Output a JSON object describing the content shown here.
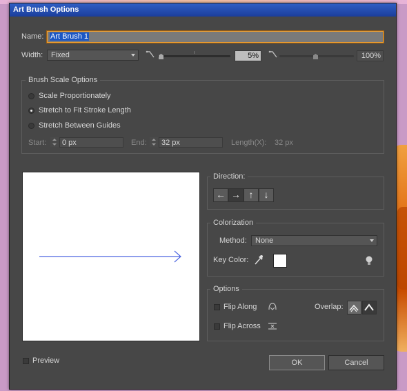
{
  "dialog": {
    "title": "Art Brush Options"
  },
  "name": {
    "label": "Name:",
    "value": "Art Brush 1"
  },
  "width": {
    "label": "Width:",
    "method": "Fixed",
    "value_text": "5%",
    "max_text": "100%"
  },
  "brush_scale": {
    "title": "Brush Scale Options",
    "options": [
      "Scale Proportionately",
      "Stretch to Fit Stroke Length",
      "Stretch Between Guides"
    ],
    "selected": "Stretch to Fit Stroke Length",
    "start_label": "Start:",
    "start_value": "0 px",
    "end_label": "End:",
    "end_value": "32 px",
    "length_label": "Length(X):",
    "length_value": "32 px"
  },
  "direction": {
    "title": "Direction:",
    "buttons": [
      "←",
      "→",
      "↑",
      "↓"
    ],
    "selected": "→"
  },
  "colorization": {
    "title": "Colorization",
    "method_label": "Method:",
    "method_value": "None",
    "key_color_label": "Key Color:",
    "key_color": "#ffffff"
  },
  "options": {
    "title": "Options",
    "flip_along": "Flip Along",
    "flip_across": "Flip Across",
    "overlap_label": "Overlap:"
  },
  "preview": {
    "label": "Preview",
    "arrow_color": "#4a64e0"
  },
  "buttons": {
    "ok": "OK",
    "cancel": "Cancel"
  },
  "colors": {
    "dialog_bg": "#474747",
    "titlebar": "#1b3e9c",
    "accent": "#f0a030"
  }
}
